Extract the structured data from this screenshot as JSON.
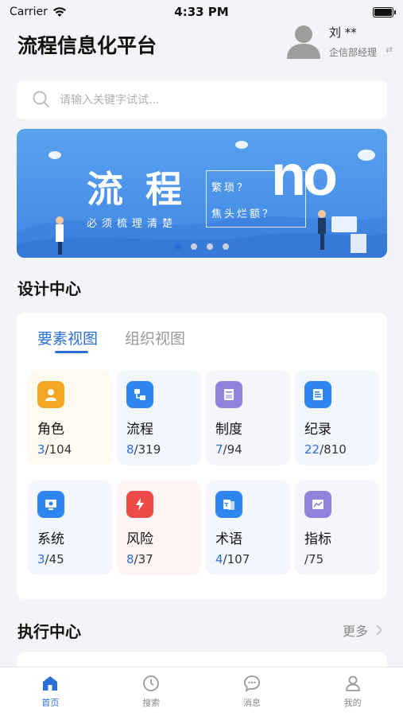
{
  "status_bar": {
    "carrier": "Carrier",
    "time": "4:33 PM"
  },
  "header": {
    "title": "流程信息化平台",
    "user_name": "刘 **",
    "user_dept": "企信部经理"
  },
  "search": {
    "placeholder": "请输入关键字试试..."
  },
  "banner": {
    "title": "流程",
    "subtitle": "必须梳理清楚",
    "box_line1": "繁琐？",
    "box_line2": "焦头烂额？",
    "big_text": "no",
    "dots": 4,
    "active_dot": 0
  },
  "design_center": {
    "title": "设计中心",
    "tabs": [
      {
        "label": "要素视图",
        "active": true
      },
      {
        "label": "组织视图",
        "active": false
      }
    ],
    "tiles": [
      {
        "label": "角色",
        "current": "3",
        "total": "/104",
        "icon": "role-icon",
        "color": "#f5a623",
        "bg": "#fffaf0"
      },
      {
        "label": "流程",
        "current": "8",
        "total": "/319",
        "icon": "process-icon",
        "color": "#2d86f0",
        "bg": "#f3f7fd"
      },
      {
        "label": "制度",
        "current": "7",
        "total": "/94",
        "icon": "regulation-icon",
        "color": "#8f84d9",
        "bg": "#f7f5fc"
      },
      {
        "label": "纪录",
        "current": "22",
        "total": "/810",
        "icon": "record-icon",
        "color": "#2d86f0",
        "bg": "#f3f7fd"
      },
      {
        "label": "系统",
        "current": "3",
        "total": "/45",
        "icon": "system-icon",
        "color": "#2d86f0",
        "bg": "#f3f7fd"
      },
      {
        "label": "风险",
        "current": "8",
        "total": "/37",
        "icon": "risk-icon",
        "color": "#ee4a4a",
        "bg": "#fff5f5"
      },
      {
        "label": "术语",
        "current": "4",
        "total": "/107",
        "icon": "glossary-icon",
        "color": "#2d86f0",
        "bg": "#f3f7fd"
      },
      {
        "label": "指标",
        "current": "",
        "total": "/75",
        "icon": "metric-icon",
        "color": "#8f84d9",
        "bg": "#f7f5fc"
      }
    ]
  },
  "exec_center": {
    "title": "执行中心",
    "more": "更多"
  },
  "tabbar": {
    "items": [
      {
        "label": "首页",
        "icon": "home-icon",
        "active": true
      },
      {
        "label": "搜索",
        "icon": "search-icon",
        "active": false
      },
      {
        "label": "消息",
        "icon": "message-icon",
        "active": false
      },
      {
        "label": "我的",
        "icon": "profile-icon",
        "active": false
      }
    ]
  },
  "colors": {
    "accent": "#2c6fd6",
    "banner": "#4a92ea",
    "background": "#f3f4f8"
  }
}
